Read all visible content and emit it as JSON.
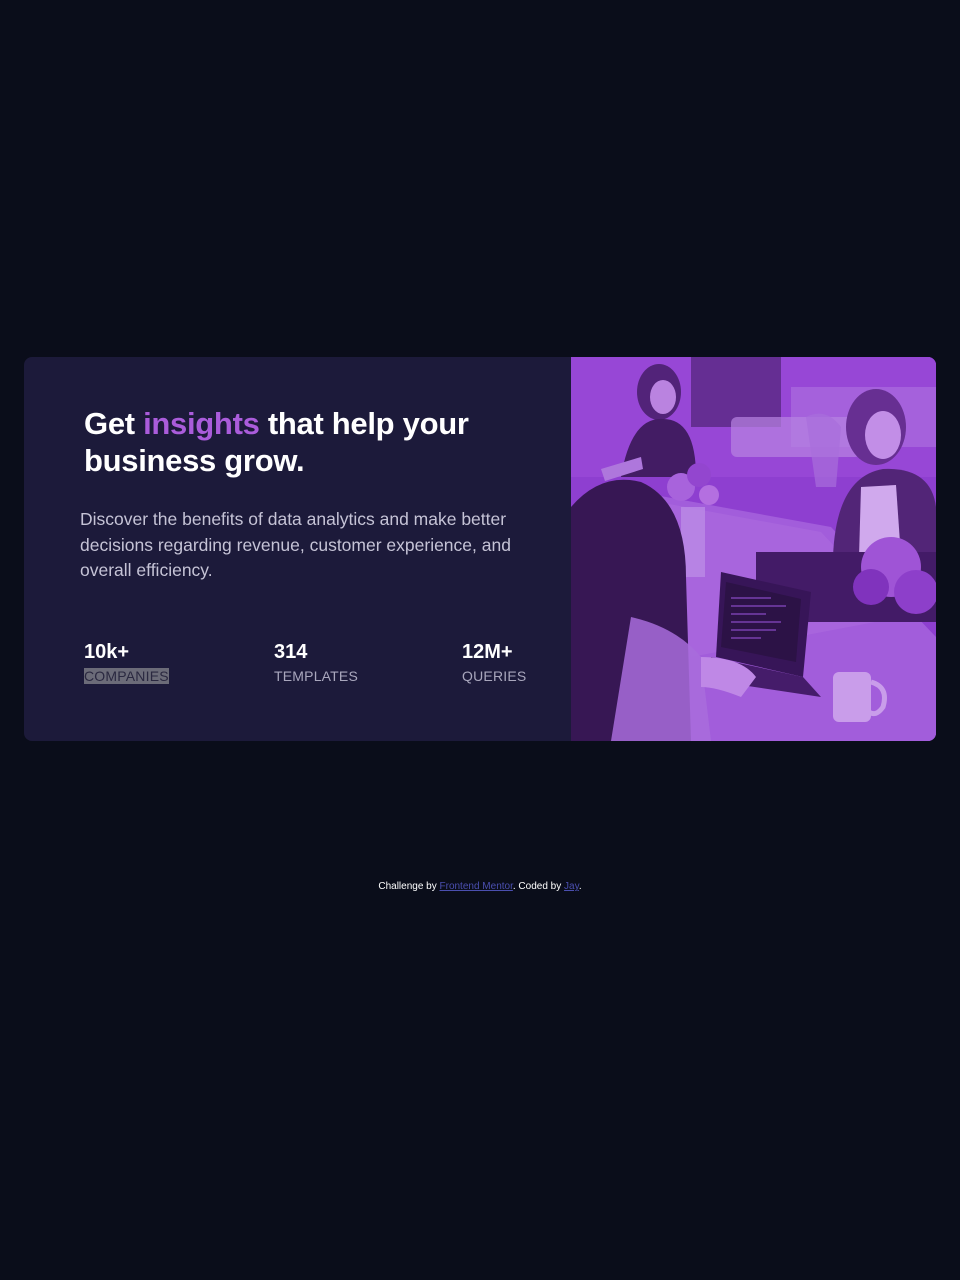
{
  "card": {
    "headline": {
      "before": "Get ",
      "accent": "insights",
      "after": " that help your business grow."
    },
    "description": "Discover the benefits of data analytics and make better decisions regarding revenue, customer experience, and overall efficiency.",
    "stats": [
      {
        "value": "10k+",
        "label": "COMPANIES"
      },
      {
        "value": "314",
        "label": "TEMPLATES"
      },
      {
        "value": "12M+",
        "label": "QUERIES"
      }
    ]
  },
  "colors": {
    "page_background": "#0a0d1a",
    "card_background": "#1c1a3a",
    "accent": "#aa5cdb",
    "image_overlay": "#8e3fd0"
  },
  "footer": {
    "prefix": "Challenge by ",
    "link1": "Frontend Mentor",
    "middle": ". Coded by ",
    "link2": "Jay",
    "suffix": "."
  }
}
